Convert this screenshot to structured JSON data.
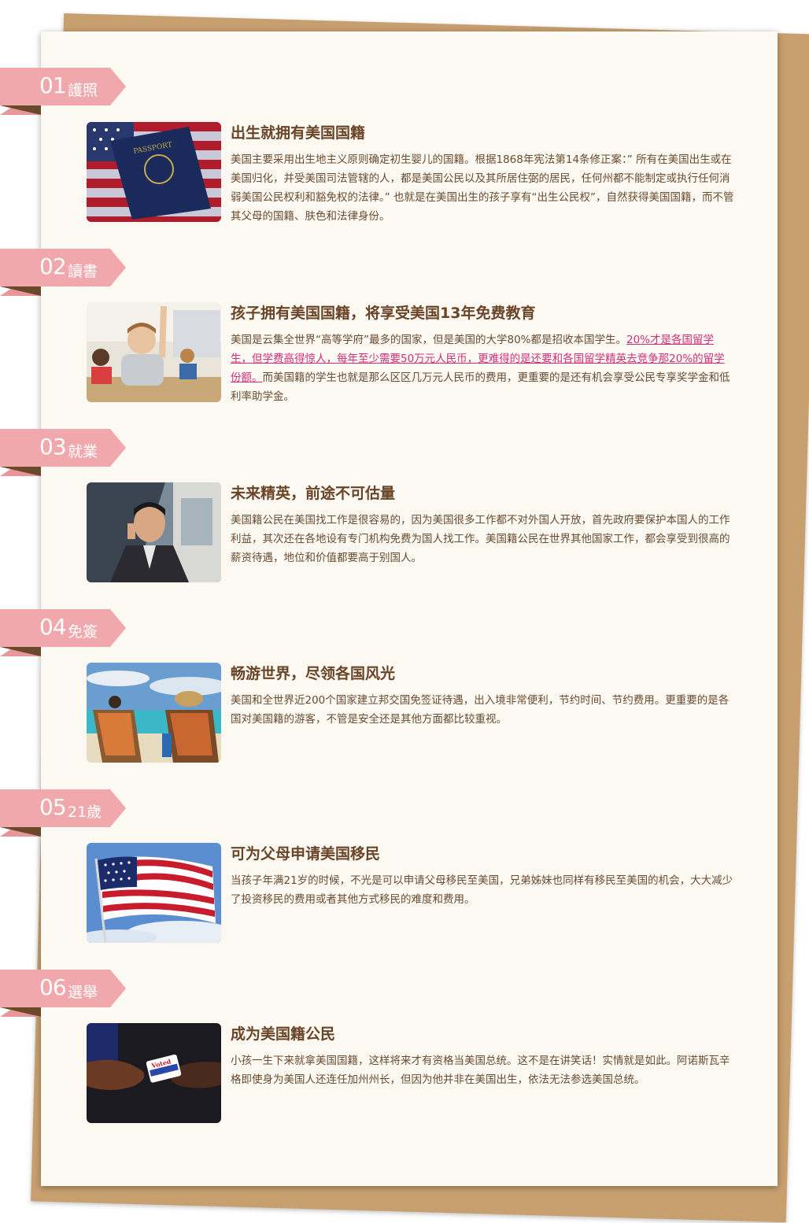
{
  "sections": [
    {
      "num": "01",
      "label": "護照",
      "title": "出生就拥有美国国籍",
      "text": "美国主要采用出生地主义原则确定初生婴儿的国籍。根据1868年宪法第14条修正案：” 所有在美国出生或在美国归化，并受美国司法管辖的人，都是美国公民以及其所居住弼的居民，任何州都不能制定或执行任何消弱美国公民权利和豁免权的法律。” 也就是在美国出生的孩子享有“出生公民权”，自然获得美国国籍，而不管其父母的国籍、肤色和法律身份。",
      "image": "passport-photo"
    },
    {
      "num": "02",
      "label": "讀書",
      "title": "孩子拥有美国国籍，将享受美国13年免费教育",
      "text_before": "美国是云集全世界“高等学府”最多的国家，但是美国的大学80%都是招收本国学生。",
      "text_highlight": "20%才是各国留学生，但学费高得惊人，每年至少需要50万元人民币，更难得的是还要和各国留学精英去竞争那20%的留学份额。",
      "text_after": "而美国籍的学生也就是那么区区几万元人民币的费用，更重要的是还有机会享受公民专享奖学金和低利率助学金。",
      "image": "classroom-photo"
    },
    {
      "num": "03",
      "label": "就業",
      "title": "未来精英，前途不可估量",
      "text": "美国籍公民在美国找工作是很容易的，因为美国很多工作都不对外国人开放，首先政府要保护本国人的工作利益，其次还在各地设有专门机构免费为国人找工作。美国籍公民在世界其他国家工作，都会享受到很高的薪资待遇，地位和价值都要高于别国人。",
      "image": "businessman-photo"
    },
    {
      "num": "04",
      "label": "免簽",
      "title": "畅游世界，尽领各国风光",
      "text": "美国和全世界近200个国家建立邦交国免签证待遇，出入境非常便利，节约时间、节约费用。更重要的是各国对美国籍的游客，不管是安全还是其他方面都比较重视。",
      "image": "beach-photo"
    },
    {
      "num": "05",
      "label": "21歲",
      "title": "可为父母申请美国移民",
      "text": "当孩子年满21岁的时候，不光是可以申请父母移民至美国，兄弟姊妹也同样有移民至美国的机会，大大减少了投资移民的费用或者其他方式移民的难度和费用。",
      "image": "flag-photo"
    },
    {
      "num": "06",
      "label": "選舉",
      "title": "成为美国籍公民",
      "text": "小孩一生下来就拿美国国籍，这样将来才有资格当美国总统。这不是在讲笑话！实情就是如此。阿诺斯瓦辛格即使身为美国人还连任加州州长，但因为他并非在美国出生，依法无法参选美国总统。",
      "image": "voting-photo",
      "sticker_text": "Voted"
    }
  ],
  "colors": {
    "ribbon": "#f0a8ac",
    "title": "#6a4428",
    "text": "#6a4a30",
    "highlight": "#d0307a",
    "paper": "#fbf9f1",
    "back_paper": "#c8a070"
  }
}
